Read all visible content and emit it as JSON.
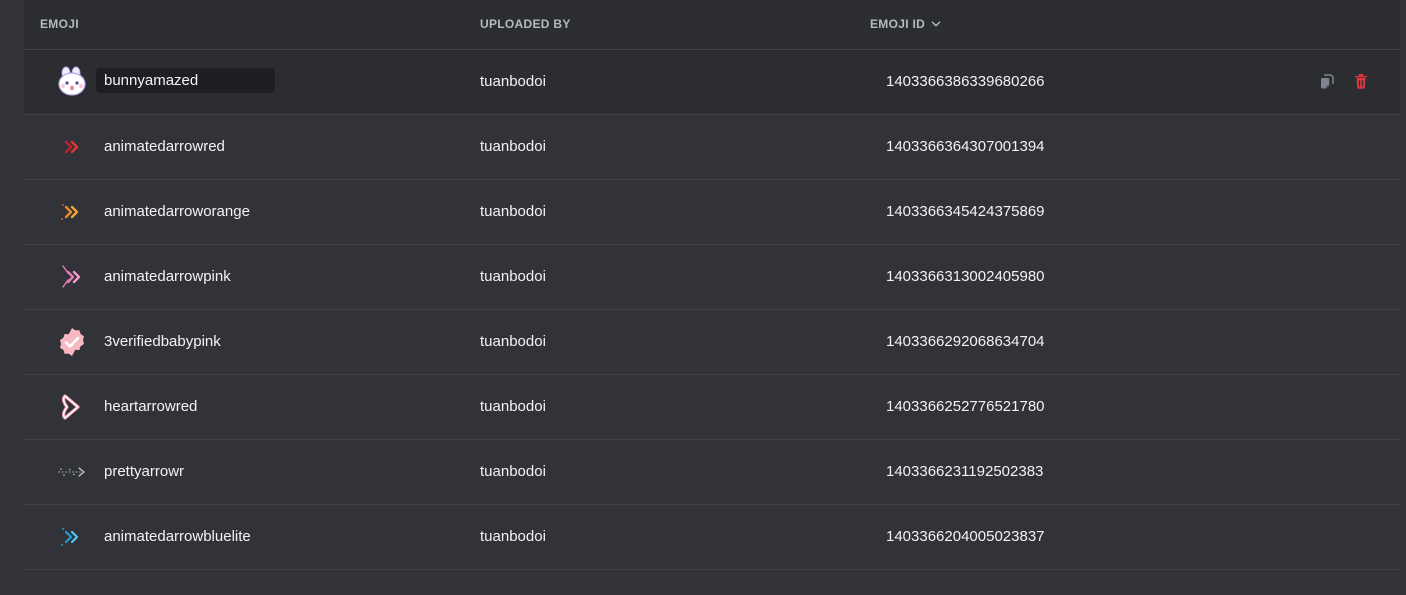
{
  "header": {
    "emoji_label": "EMOJI",
    "uploader_label": "UPLOADED BY",
    "id_label": "EMOJI ID"
  },
  "colors": {
    "background": "#313338",
    "row_active": "#2b2d31",
    "divider": "#3f4147",
    "delete_red": "#da373c"
  },
  "rows": [
    {
      "name": "bunnyamazed",
      "uploader": "tuanbodoi",
      "id": "1403366386339680266",
      "icon": "bunny-amazed-emoji"
    },
    {
      "name": "animatedarrowred",
      "uploader": "tuanbodoi",
      "id": "1403366364307001394",
      "icon": "red-arrow-emoji"
    },
    {
      "name": "animatedarroworange",
      "uploader": "tuanbodoi",
      "id": "1403366345424375869",
      "icon": "orange-arrow-emoji"
    },
    {
      "name": "animatedarrowpink",
      "uploader": "tuanbodoi",
      "id": "1403366313002405980",
      "icon": "pink-arrow-emoji"
    },
    {
      "name": "3verifiedbabypink",
      "uploader": "tuanbodoi",
      "id": "1403366292068634704",
      "icon": "verified-badge-emoji"
    },
    {
      "name": "heartarrowred",
      "uploader": "tuanbodoi",
      "id": "1403366252776521780",
      "icon": "heart-arrow-emoji"
    },
    {
      "name": "prettyarrowr",
      "uploader": "tuanbodoi",
      "id": "1403366231192502383",
      "icon": "pretty-arrow-emoji"
    },
    {
      "name": "animatedarrowbluelite",
      "uploader": "tuanbodoi",
      "id": "1403366204005023837",
      "icon": "blue-arrow-emoji"
    }
  ]
}
